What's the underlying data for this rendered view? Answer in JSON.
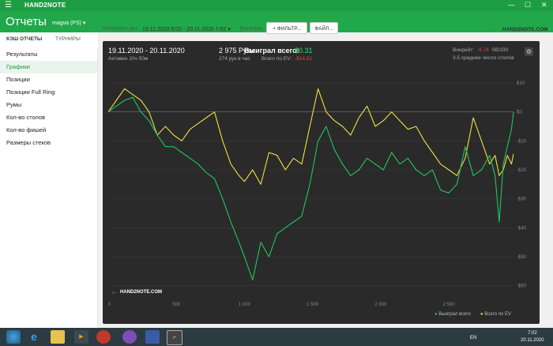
{
  "window": {
    "menu_icon": "hamburger-icon",
    "app_name": "HAND2NOTE",
    "minimize": "—",
    "maximize": "☐",
    "close": "✕"
  },
  "header": {
    "title": "Отчеты",
    "account": "magva (PS)",
    "account_icon": "chevron-down-icon"
  },
  "tabs": [
    {
      "label": "КЭШ ОТЧЕТЫ",
      "active": true
    },
    {
      "label": "ТУРНИРЫ",
      "active": false
    }
  ],
  "sidebar": {
    "items": [
      {
        "label": "Результаты",
        "active": false
      },
      {
        "label": "Графики",
        "active": true
      },
      {
        "label": "Позиции",
        "active": false
      },
      {
        "label": "Позиции Full Ring",
        "active": false
      },
      {
        "label": "Румы",
        "active": false
      },
      {
        "label": "Кол-во столов",
        "active": false
      },
      {
        "label": "Кол-во фишей",
        "active": false
      },
      {
        "label": "Размеры стеков",
        "active": false
      }
    ]
  },
  "toolbar": {
    "interval_label": "Интервал дат:",
    "interval_value": "19.11.2020 8:02 - 20.11.2020 7:02",
    "filters_label": "Фильтры:",
    "filter_button": "ФИЛЬТР...",
    "file_button": "ФАЙЛ...",
    "brand": "HAND2NOTE.COM"
  },
  "summary": {
    "date_range": "19.11.2020 - 20.11.2020",
    "active": "Активен 10ч 50м",
    "hands": "2 975 Руки",
    "hands_rate": "274 рук в час",
    "won_label": "Выиграл всего:",
    "won_value": "$0.31",
    "ev_label": "Всего по EV:",
    "ev_value": "-$14.51",
    "winrate_label": "Винрейт:",
    "winrate_value": "-9.74",
    "winrate_unit": "бб/100",
    "tables_avg": "3.5 среднее число столов",
    "settings_icon": "gear-icon",
    "watermark": "HAND2NOTE.COM"
  },
  "colors": {
    "green": "#1e9e44",
    "won_line": "#22c55e",
    "ev_line": "#f0e040",
    "negative": "#e04848",
    "positive": "#3ddc6b"
  },
  "chart_data": {
    "type": "line",
    "title": "",
    "xlabel": "",
    "ylabel": "",
    "xlim": [
      0,
      2975
    ],
    "ylim": [
      -65,
      13
    ],
    "x_ticks": [
      0,
      500,
      1000,
      1500,
      2000,
      2500
    ],
    "x_tick_labels": [
      "0",
      "500",
      "1 000",
      "1 500",
      "2 000",
      "2 500"
    ],
    "y_ticks": [
      10,
      0,
      -10,
      -20,
      -30,
      -40,
      -50,
      -60
    ],
    "y_tick_labels": [
      "$10",
      "$0",
      "-$10",
      "-$20",
      "-$30",
      "-$40",
      "-$50",
      "-$60"
    ],
    "legend_position": "bottom-right",
    "series": [
      {
        "name": "Выиграл всего",
        "x": [
          0,
          60,
          120,
          180,
          240,
          300,
          360,
          420,
          480,
          540,
          600,
          660,
          720,
          780,
          840,
          900,
          960,
          1000,
          1060,
          1120,
          1180,
          1240,
          1300,
          1360,
          1420,
          1480,
          1540,
          1600,
          1660,
          1720,
          1780,
          1840,
          1900,
          1960,
          2020,
          2080,
          2140,
          2200,
          2260,
          2320,
          2380,
          2440,
          2500,
          2560,
          2620,
          2680,
          2740,
          2800,
          2840,
          2870,
          2900,
          2930,
          2960,
          2975
        ],
        "values": [
          0,
          2,
          4,
          5,
          0,
          -3,
          -8,
          -12,
          -12,
          -14,
          -16,
          -18,
          -21,
          -23,
          -30,
          -38,
          -45,
          -50,
          -58,
          -45,
          -50,
          -42,
          -40,
          -38,
          -36,
          -25,
          -10,
          -5,
          -13,
          -18,
          -22,
          -20,
          -16,
          -18,
          -20,
          -14,
          -18,
          -16,
          -20,
          -22,
          -20,
          -27,
          -28,
          -25,
          -12,
          -22,
          -20,
          -15,
          -22,
          -38,
          -18,
          -12,
          -6,
          0
        ]
      },
      {
        "name": "Всего по EV",
        "x": [
          0,
          60,
          120,
          180,
          240,
          300,
          360,
          420,
          480,
          540,
          600,
          660,
          720,
          780,
          840,
          900,
          960,
          1000,
          1060,
          1120,
          1180,
          1240,
          1300,
          1360,
          1420,
          1480,
          1540,
          1600,
          1660,
          1720,
          1780,
          1840,
          1900,
          1960,
          2020,
          2080,
          2140,
          2200,
          2260,
          2320,
          2380,
          2440,
          2500,
          2560,
          2620,
          2680,
          2740,
          2800,
          2840,
          2870,
          2900,
          2930,
          2960,
          2975
        ],
        "values": [
          0,
          4,
          8,
          6,
          4,
          0,
          -8,
          -5,
          -8,
          -10,
          -6,
          -4,
          -2,
          0,
          -10,
          -18,
          -22,
          -24,
          -20,
          -25,
          -14,
          -15,
          -20,
          -16,
          -18,
          -5,
          8,
          0,
          -3,
          -5,
          -8,
          -2,
          2,
          -5,
          -3,
          0,
          -3,
          -6,
          -5,
          -10,
          -14,
          -18,
          -20,
          -22,
          -16,
          -2,
          -10,
          -18,
          -15,
          -22,
          -20,
          -15,
          -18,
          -14.5
        ]
      }
    ]
  },
  "taskbar": {
    "icons": [
      "windows-start-icon",
      "ie-icon",
      "explorer-icon",
      "media-icon",
      "opera-icon",
      "viber-icon",
      "save-icon",
      "hand2note-icon"
    ],
    "lang": "EN",
    "time": "7:02",
    "date": "20.11.2020"
  }
}
